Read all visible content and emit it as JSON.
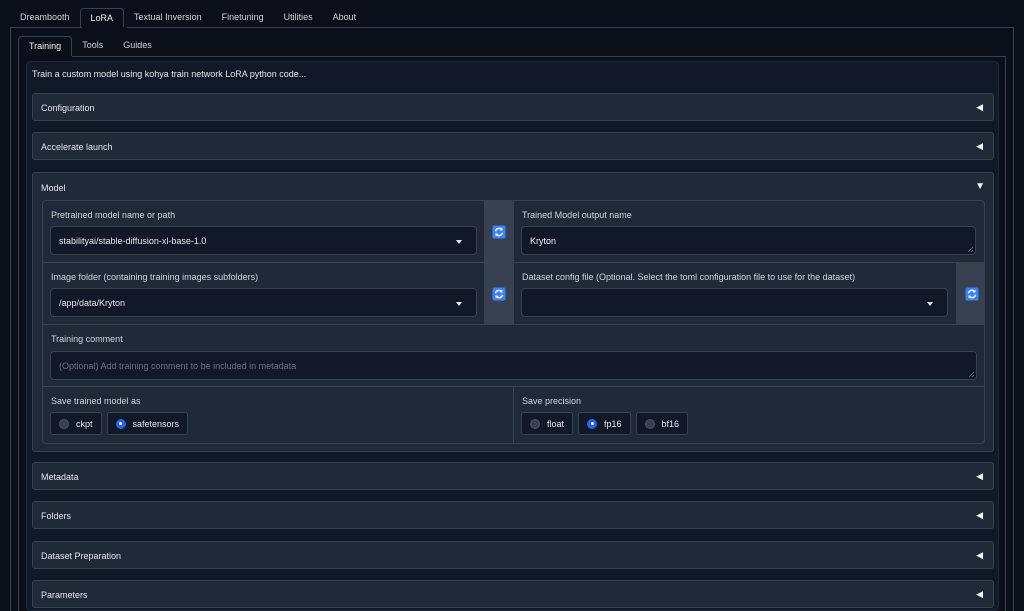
{
  "top_tabs": [
    {
      "label": "Dreambooth"
    },
    {
      "label": "LoRA"
    },
    {
      "label": "Textual Inversion"
    },
    {
      "label": "Finetuning"
    },
    {
      "label": "Utilities"
    },
    {
      "label": "About"
    }
  ],
  "active_top_tab": "LoRA",
  "sub_tabs": [
    {
      "label": "Training"
    },
    {
      "label": "Tools"
    },
    {
      "label": "Guides"
    }
  ],
  "active_sub_tab": "Training",
  "description": "Train a custom model using kohya train network LoRA python code...",
  "accordions_collapsed": {
    "configuration": "Configuration",
    "accelerate": "Accelerate launch",
    "metadata": "Metadata",
    "folders": "Folders",
    "dataset": "Dataset Preparation",
    "parameters": "Parameters"
  },
  "arrows": {
    "collapsed": "◀",
    "expanded": "▼"
  },
  "model": {
    "title": "Model",
    "pretrained": {
      "label": "Pretrained model name or path",
      "value": "stabilityai/stable-diffusion-xl-base-1.0"
    },
    "output_name": {
      "label": "Trained Model output name",
      "value": "Kryton"
    },
    "image_folder": {
      "label": "Image folder (containing training images subfolders)",
      "value": "/app/data/Kryton"
    },
    "dataset_config": {
      "label": "Dataset config file (Optional. Select the toml configuration file to use for the dataset)",
      "value": ""
    },
    "training_comment": {
      "label": "Training comment",
      "placeholder": "(Optional) Add training comment to be included in metadata"
    },
    "save_as": {
      "label": "Save trained model as",
      "options": [
        "ckpt",
        "safetensors"
      ],
      "selected": "safetensors"
    },
    "save_precision": {
      "label": "Save precision",
      "options": [
        "float",
        "fp16",
        "bf16"
      ],
      "selected": "fp16"
    }
  },
  "icons": {
    "refresh": "refresh-icon",
    "dropdown": "chevron-down-icon",
    "collapsed": "triangle-left-icon",
    "expanded": "triangle-down-icon"
  },
  "colors": {
    "background": "#0b0f19",
    "panel": "#1f2937",
    "border": "#374151",
    "accent": "#2563eb",
    "refresh_icon": "#3b82f6"
  }
}
